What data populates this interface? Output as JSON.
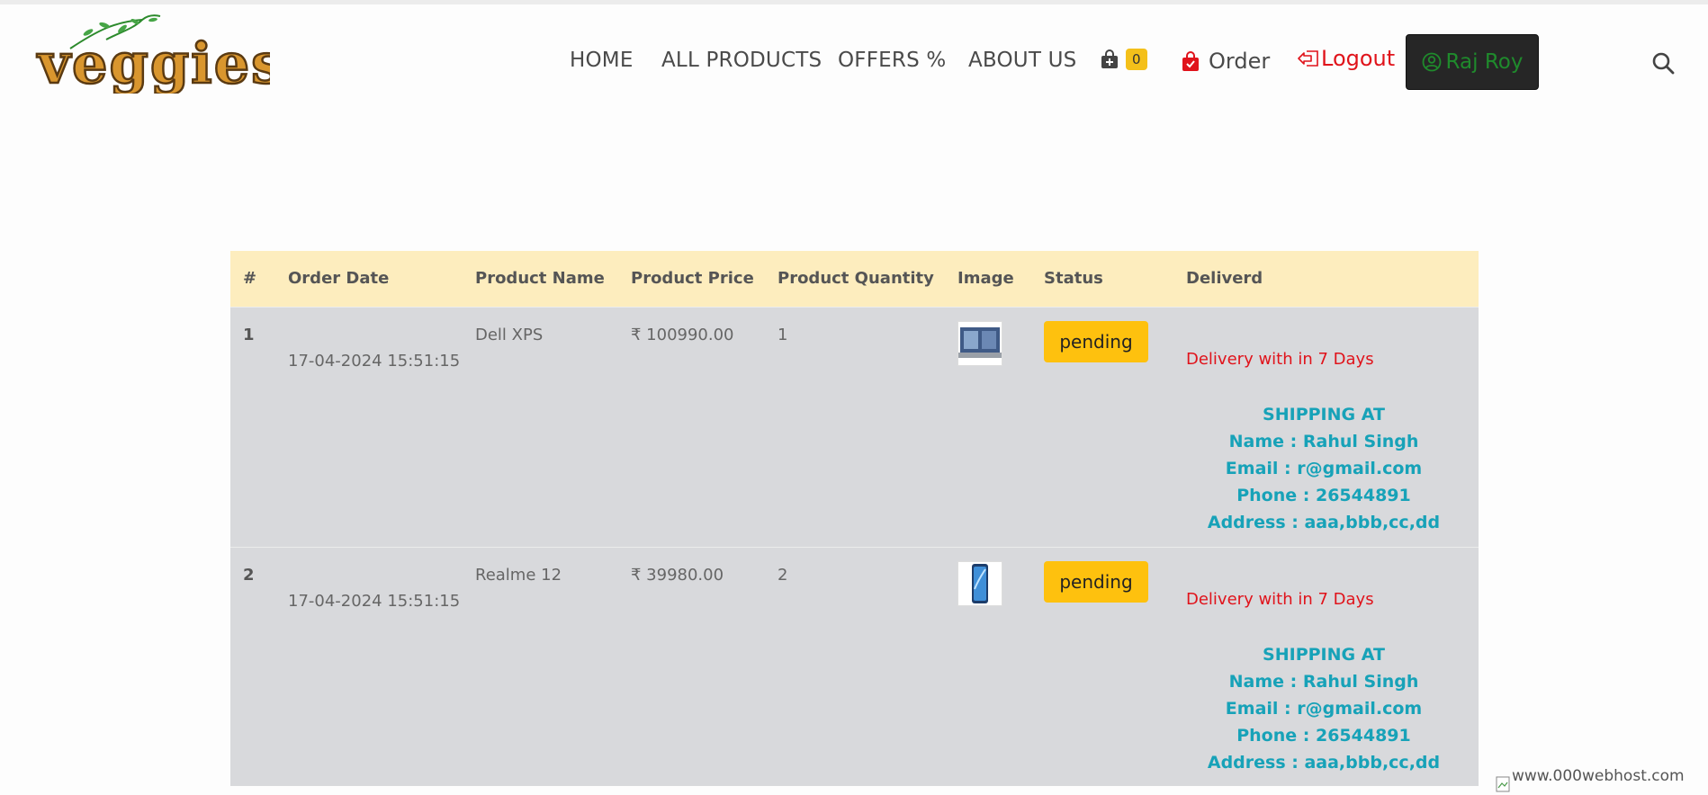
{
  "header": {
    "logo_text": "veggies",
    "nav": {
      "home": "HOME",
      "all_products": "ALL PRODUCTS",
      "offers": "OFFERS %",
      "about": "ABOUT US"
    },
    "cart_count": "0",
    "order_label": "Order",
    "logout_label": "Logout",
    "user_name": "Raj Roy",
    "icons": [
      "cart-icon",
      "shopping-bag-icon",
      "logout-icon",
      "user-circle-icon",
      "search-icon"
    ],
    "colors": {
      "badge": "#f4c01a",
      "logout": "#e0131b",
      "user_text": "#1f8a2c",
      "user_bg": "#262626"
    }
  },
  "table": {
    "headers": {
      "num": "#",
      "date": "Order Date",
      "name": "Product Name",
      "price": "Product Price",
      "qty": "Product Quantity",
      "image": "Image",
      "status": "Status",
      "delivered": "Deliverd"
    },
    "colors": {
      "header_bg": "#fdedbe",
      "row_bg": "#d8d9dc",
      "status_bg": "#fec10e",
      "shipping_text": "#17a2b8",
      "delivery_text": "#e0131b"
    },
    "rows": [
      {
        "index": "1",
        "date": "17-04-2024 15:51:15",
        "product": "Dell XPS",
        "price": "₹ 100990.00",
        "quantity": "1",
        "image": "laptop",
        "status": "pending",
        "delivery": "Delivery with in 7 Days",
        "shipping": {
          "title": "SHIPPING AT",
          "name": "Name : Rahul Singh",
          "email": "Email : r@gmail.com",
          "phone": "Phone : 26544891",
          "address": "Address : aaa,bbb,cc,dd"
        }
      },
      {
        "index": "2",
        "date": "17-04-2024 15:51:15",
        "product": "Realme 12",
        "price": "₹ 39980.00",
        "quantity": "2",
        "image": "smartphone",
        "status": "pending",
        "delivery": "Delivery with in 7 Days",
        "shipping": {
          "title": "SHIPPING AT",
          "name": "Name : Rahul Singh",
          "email": "Email : r@gmail.com",
          "phone": "Phone : 26544891",
          "address": "Address : aaa,bbb,cc,dd"
        }
      }
    ]
  },
  "footer": {
    "broken_image_alt": "www.000webhost.com"
  }
}
